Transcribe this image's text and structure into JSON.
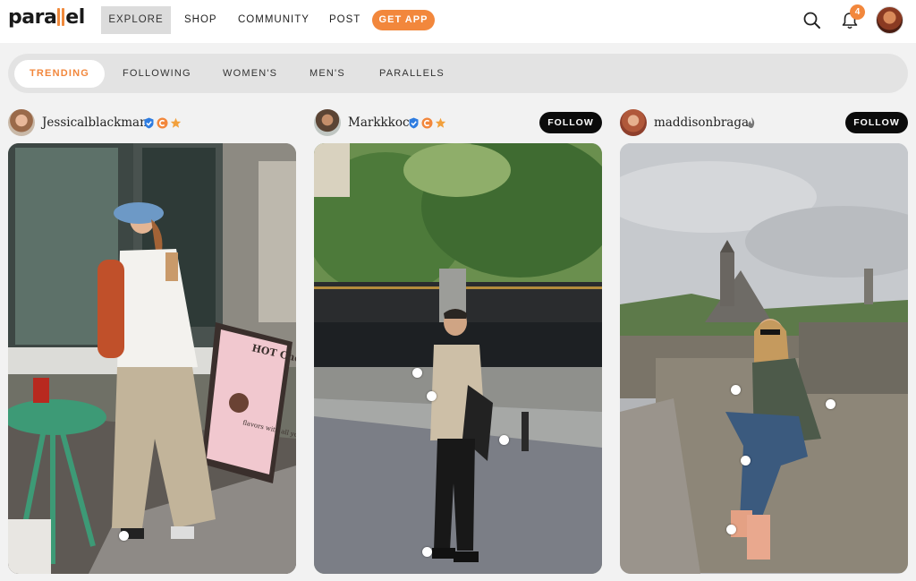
{
  "header": {
    "logo_left": "para",
    "logo_right": "el",
    "nav": {
      "explore": "EXPLORE",
      "shop": "SHOP",
      "community": "COMMUNITY",
      "post": "POST"
    },
    "get_app": "GET APP",
    "notification_count": "4",
    "icons": {
      "search": "search-icon",
      "bell": "bell-icon"
    },
    "accent_color": "#f2873c"
  },
  "tabs": [
    {
      "label": "TRENDING",
      "active": true
    },
    {
      "label": "FOLLOWING",
      "active": false
    },
    {
      "label": "WOMEN'S",
      "active": false
    },
    {
      "label": "MEN'S",
      "active": false
    },
    {
      "label": "PARALLELS",
      "active": false
    }
  ],
  "posts": [
    {
      "username": "Jessicalblackman",
      "badges": [
        "verified-icon",
        "creator-icon",
        "star-icon"
      ],
      "follow": ""
    },
    {
      "username": "Markkkoc",
      "badges": [
        "verified-icon",
        "creator-icon",
        "star-icon"
      ],
      "follow": "FOLLOW"
    },
    {
      "username": "maddisonbraga",
      "badges": [
        "flame-icon"
      ],
      "follow": "FOLLOW"
    }
  ],
  "sign": {
    "title": "HOT Chocolate",
    "subtitle": "flavors with all your fave toppings"
  }
}
